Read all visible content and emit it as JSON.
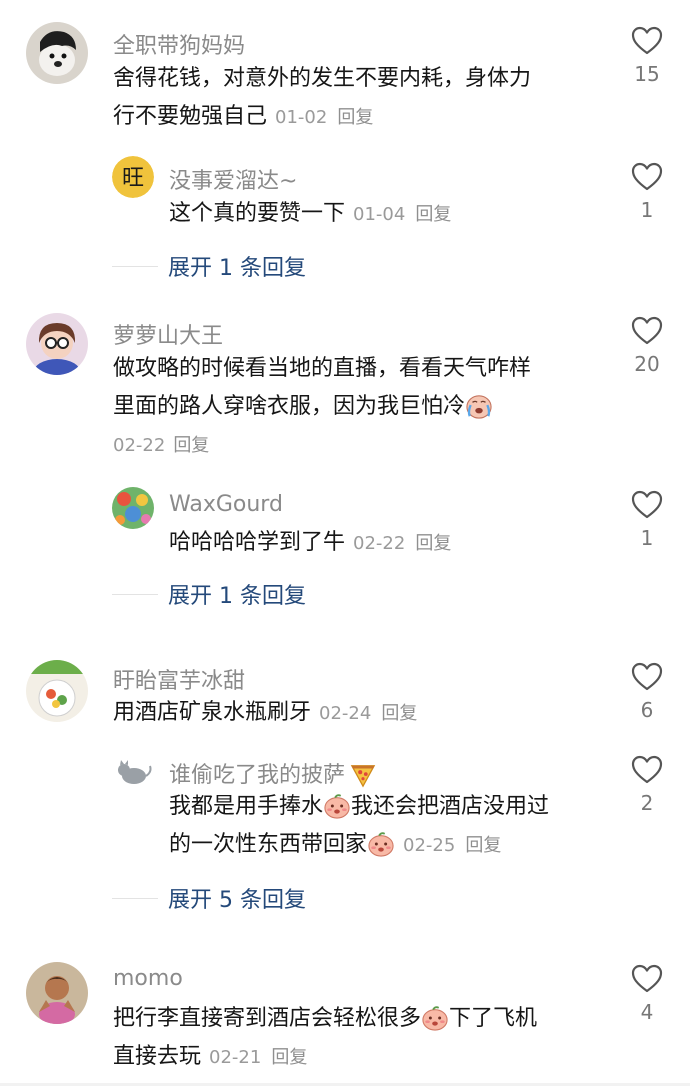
{
  "comments": [
    {
      "username": "全职带狗妈妈",
      "text_line1": "舍得花钱，对意外的发生不要内耗，身体力",
      "text_line2": "行不要勉强自己",
      "time": "01-02",
      "reply": "回复",
      "likes": "15",
      "sub": {
        "username": "没事爱溜达~",
        "avatar_text": "旺",
        "text": "这个真的要赞一下",
        "time": "01-04",
        "reply": "回复",
        "likes": "1"
      },
      "expand": "展开 1 条回复"
    },
    {
      "username": "萝萝山大王",
      "text_line1": "做攻略的时候看当地的直播，看看天气咋样",
      "text_line2": "里面的路人穿啥衣服，因为我巨怕冷",
      "time": "02-22",
      "reply": "回复",
      "likes": "20",
      "sub": {
        "username": "WaxGourd",
        "text": "哈哈哈哈学到了牛",
        "time": "02-22",
        "reply": "回复",
        "likes": "1"
      },
      "expand": "展开 1 条回复"
    },
    {
      "username": "盱眙富芋冰甜",
      "text_line1": "用酒店矿泉水瓶刷牙",
      "time": "02-24",
      "reply": "回复",
      "likes": "6",
      "sub": {
        "username": "谁偷吃了我的披萨",
        "text_line1a": "我都是用手捧水",
        "text_line1b": "我还会把酒店没用过",
        "text_line2": "的一次性东西带回家",
        "time": "02-25",
        "reply": "回复",
        "likes": "2"
      },
      "expand": "展开 5 条回复"
    },
    {
      "username": "momo",
      "text_line1a": "把行李直接寄到酒店会轻松很多",
      "text_line1b": "下了飞机",
      "text_line2": "直接去玩",
      "time": "02-21",
      "reply": "回复",
      "likes": "4"
    }
  ],
  "icons": {
    "like": "heart-outline-icon",
    "emoji_cry": "crying-emoji-icon",
    "emoji_peach": "peach-face-emoji-icon",
    "pizza": "pizza-icon"
  },
  "colors": {
    "expand_link": "#24497a",
    "username": "#8a8a8a",
    "meta": "#9a9a9a"
  }
}
